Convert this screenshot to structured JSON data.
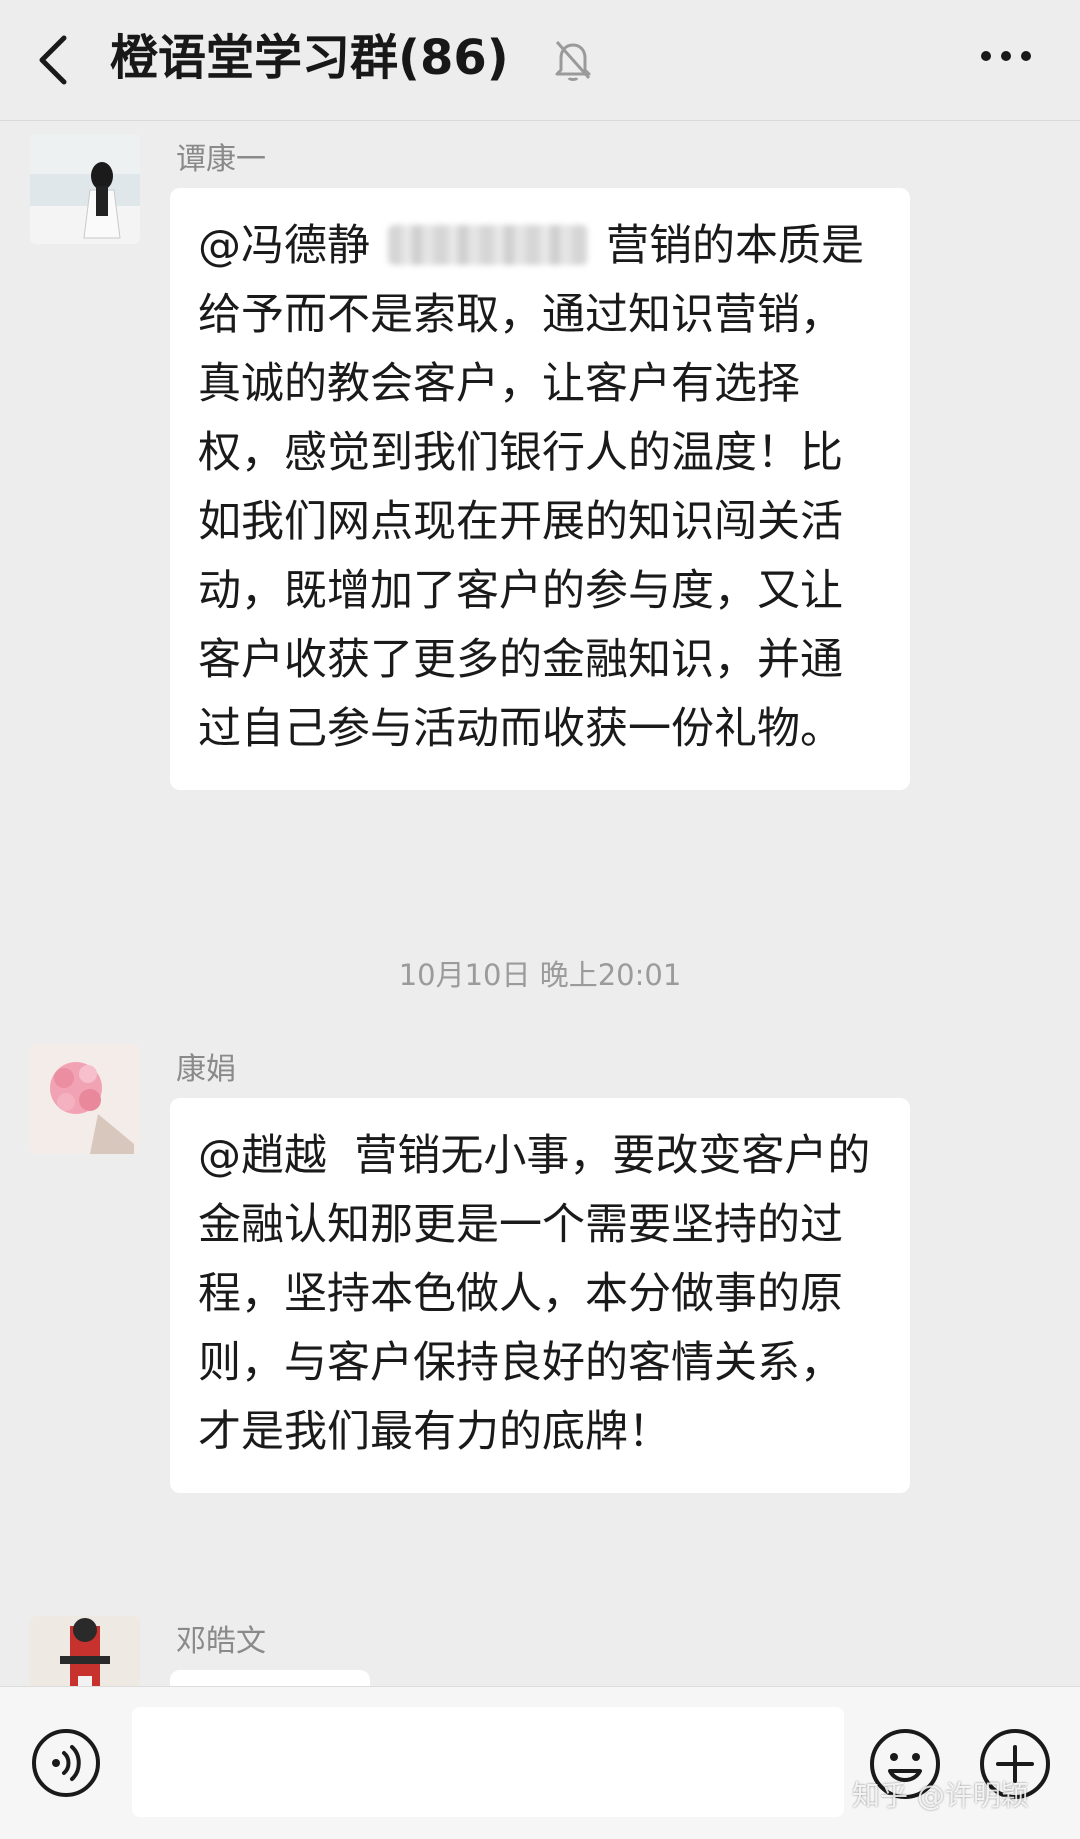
{
  "header": {
    "title": "橙语堂学习群(86)",
    "back_icon": "chevron-left-icon",
    "mute_icon": "bell-off-icon",
    "more_icon": "more-horizontal-icon"
  },
  "messages": [
    {
      "sender": "谭康一",
      "mention": "@冯德静",
      "text": "营销的本质是给予而不是索取，通过知识营销，真诚的教会客户，让客户有选择权，感觉到我们银行人的温度！比如我们网点现在开展的知识闯关活动，既增加了客户的参与度，又让客户收获了更多的金融知识，并通过自己参与活动而收获一份礼物。"
    },
    {
      "sender": "康娟",
      "mention": "@趙越",
      "text": "营销无小事，要改变客户的金融认知那更是一个需要坚持的过程，坚持本色做人，本分做事的原则，与客户保持良好的客情关系，才是我们最有力的底牌！"
    },
    {
      "sender": "邓皓文"
    }
  ],
  "timestamp": "10月10日 晚上20:01",
  "input": {
    "value": "",
    "voice_icon": "voice-icon",
    "emoji_icon": "emoji-icon",
    "plus_icon": "plus-circle-icon"
  },
  "watermark": "知乎 @许明颖",
  "colors": {
    "background": "#ededed",
    "bubble": "#ffffff",
    "sender_text": "#8a8a8a"
  }
}
